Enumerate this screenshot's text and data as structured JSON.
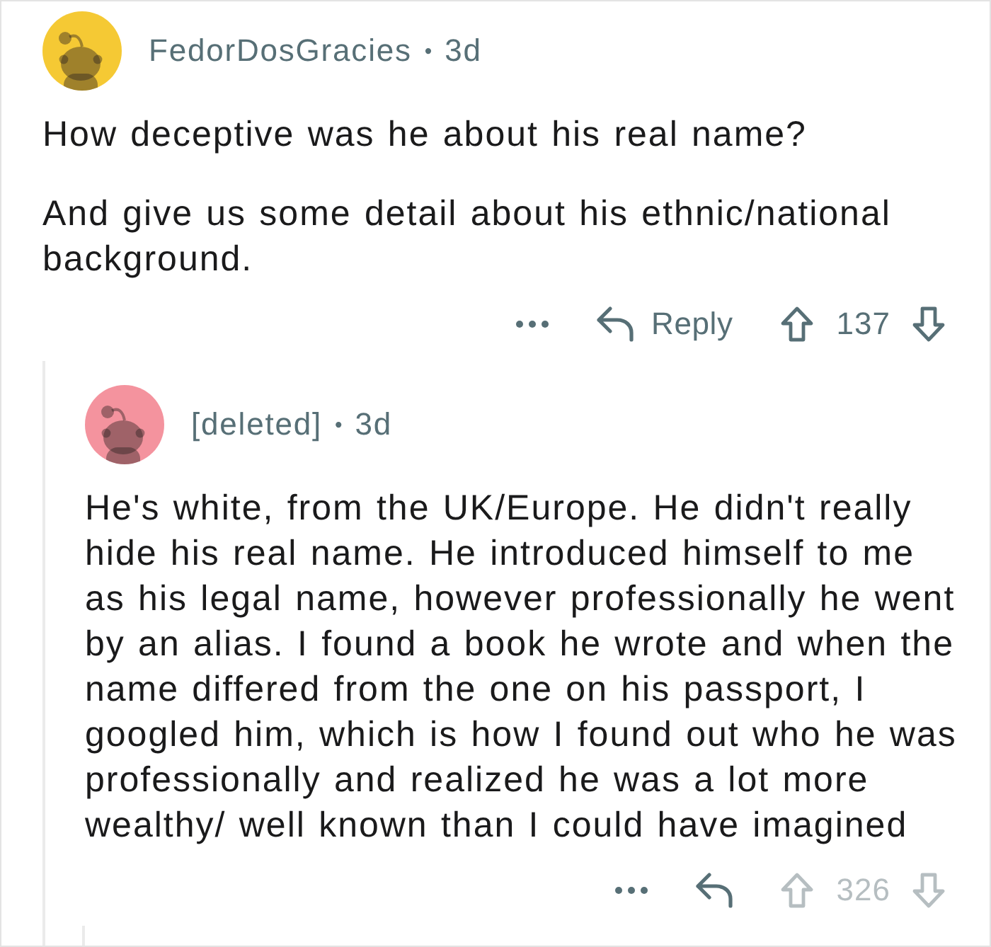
{
  "comments": [
    {
      "avatar": {
        "color": "#f5c934"
      },
      "author": "FedorDosGracies",
      "separator": "•",
      "age": "3d",
      "paragraphs": [
        "How deceptive was he about his real name?",
        "And give us some detail about his ethnic/national background."
      ],
      "reply_label": "Reply",
      "score": "137",
      "votes_disabled": false,
      "children": [
        {
          "avatar": {
            "color": "#f4939e"
          },
          "author": "[deleted]",
          "separator": "•",
          "age": "3d",
          "paragraphs": [
            "He's white, from the UK/Europe. He didn't really hide his real name. He introduced himself to me as his legal name, however professionally he went by an alias. I found a book he wrote and when the name differed from the one on his passport, I googled him, which is how I found out who he was professionally and realized he was a lot more wealthy/ well known than I could have imagined"
          ],
          "score": "326",
          "votes_disabled": true,
          "more_replies": true
        }
      ]
    }
  ]
}
